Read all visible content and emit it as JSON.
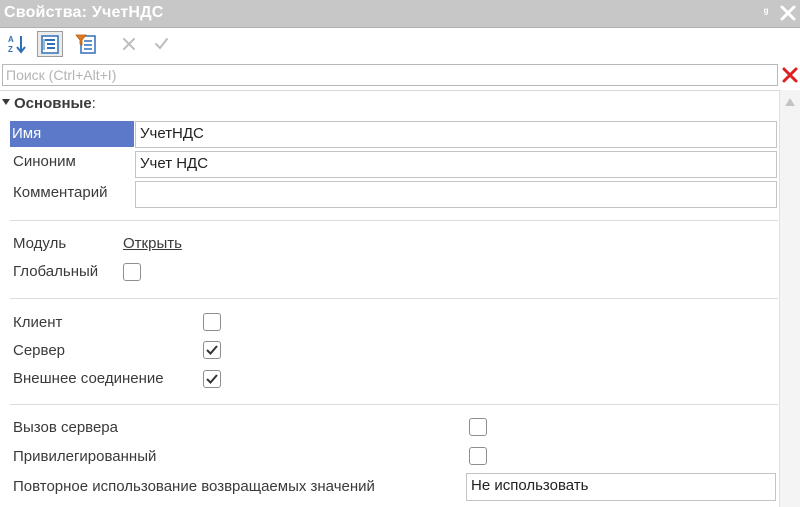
{
  "window": {
    "title": "Свойства: УчетНДС",
    "pin_glyph": "ᵍ"
  },
  "toolbar": {
    "icons": [
      "sort-alphabetical-icon",
      "categories-icon",
      "filter-icon",
      "cancel-icon",
      "confirm-icon"
    ]
  },
  "search": {
    "placeholder": "Поиск (Ctrl+Alt+I)",
    "value": ""
  },
  "section": {
    "title": "Основные",
    "colon": ":"
  },
  "properties": {
    "name": {
      "label": "Имя",
      "value": "УчетНДС"
    },
    "synonym": {
      "label": "Синоним",
      "value": "Учет НДС"
    },
    "comment": {
      "label": "Комментарий",
      "value": ""
    },
    "module": {
      "label": "Модуль",
      "link": "Открыть"
    },
    "global": {
      "label": "Глобальный",
      "checked": false
    },
    "client": {
      "label": "Клиент",
      "checked": false
    },
    "server": {
      "label": "Сервер",
      "checked": true
    },
    "external_connection": {
      "label": "Внешнее соединение",
      "checked": true
    },
    "server_call": {
      "label": "Вызов сервера",
      "checked": false
    },
    "privileged": {
      "label": "Привилегированный",
      "checked": false
    },
    "reuse_return_values": {
      "label": "Повторное использование возвращаемых значений",
      "value": "Не использовать"
    }
  },
  "colors": {
    "titlebar": "#c7c7c7",
    "selection": "#5b78c9",
    "close_red": "#e02020",
    "accent_blue": "#2f6fb5"
  }
}
